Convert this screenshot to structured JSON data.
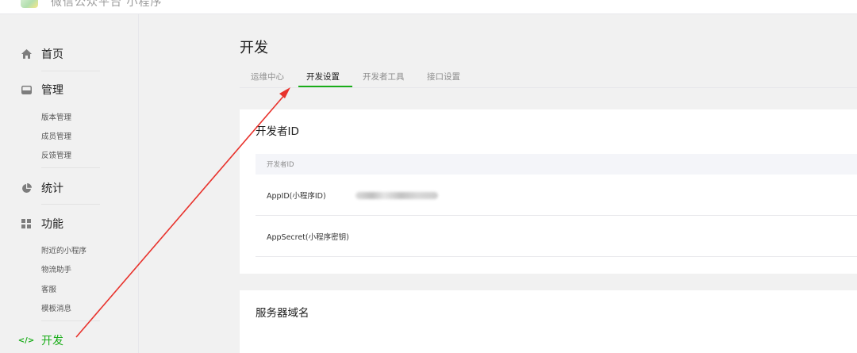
{
  "topbar": {
    "title": "微信公众平台 小程序"
  },
  "sidebar": {
    "home": "首页",
    "manage": "管理",
    "manage_items": [
      "版本管理",
      "成员管理",
      "反馈管理"
    ],
    "stats": "统计",
    "features": "功能",
    "feature_items": [
      "附近的小程序",
      "物流助手",
      "客服",
      "模板消息"
    ],
    "dev": "开发",
    "dev_icon_glyph": "</>"
  },
  "main": {
    "page_title": "开发",
    "tabs": [
      "运维中心",
      "开发设置",
      "开发者工具",
      "接口设置"
    ],
    "active_tab": "开发设置"
  },
  "developer_id_card": {
    "title": "开发者ID",
    "table_header": "开发者ID",
    "rows": [
      {
        "label": "AppID(小程序ID)"
      },
      {
        "label": "AppSecret(小程序密钥)"
      }
    ]
  },
  "server_domain_card": {
    "title": "服务器域名"
  },
  "colors": {
    "accent": "#1aad19",
    "arrow": "#e8322c",
    "background": "#f1f1f1"
  },
  "icons": {
    "home": "home-icon",
    "manage": "inbox-icon",
    "stats": "pie-chart-icon",
    "features": "grid-icon",
    "dev": "code-icon"
  }
}
